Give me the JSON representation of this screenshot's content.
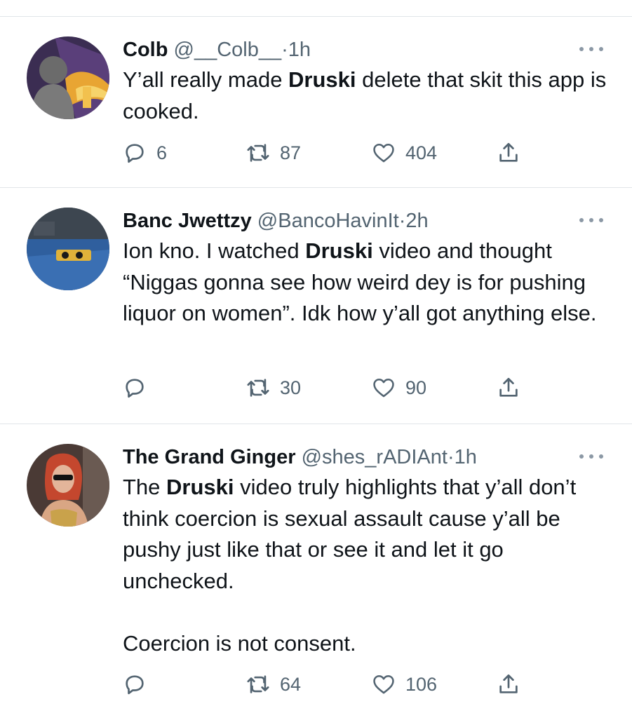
{
  "colors": {
    "text": "#0f1419",
    "secondary": "#536471",
    "separator": "#e1e5e8"
  },
  "tweets": [
    {
      "name": "Colb",
      "handle": "@__Colb__",
      "dot": "·",
      "time": "1h",
      "avatar_icon": "user-avatar-icon",
      "text": {
        "a": "Y’all really made ",
        "highlight": "Druski",
        "b": " delete that skit this app is cooked."
      },
      "replies": "6",
      "retweets": "87",
      "likes": "404"
    },
    {
      "name": "Banc Jwettzy",
      "handle": "@BancoHavinIt",
      "dot": "·",
      "time": "2h",
      "avatar_icon": "user-avatar-icon",
      "text": {
        "a": "Ion kno. I watched ",
        "highlight": "Druski",
        "b": " video and thought “Niggas gonna see how weird dey is for pushing liquor on women”. Idk how y’all got anything else."
      },
      "replies": "",
      "retweets": "30",
      "likes": "90"
    },
    {
      "name": "The Grand Ginger",
      "handle": "@shes_rADIAnt",
      "dot": "·",
      "time": "1h",
      "avatar_icon": "user-avatar-icon",
      "text": {
        "a": "The ",
        "highlight": "Druski",
        "b": " video truly highlights that y’all don’t think coercion is sexual assault cause y’all be pushy just like that or see it and let it go unchecked.",
        "p2": "Coercion is not consent."
      },
      "replies": "",
      "retweets": "64",
      "likes": "106"
    }
  ]
}
